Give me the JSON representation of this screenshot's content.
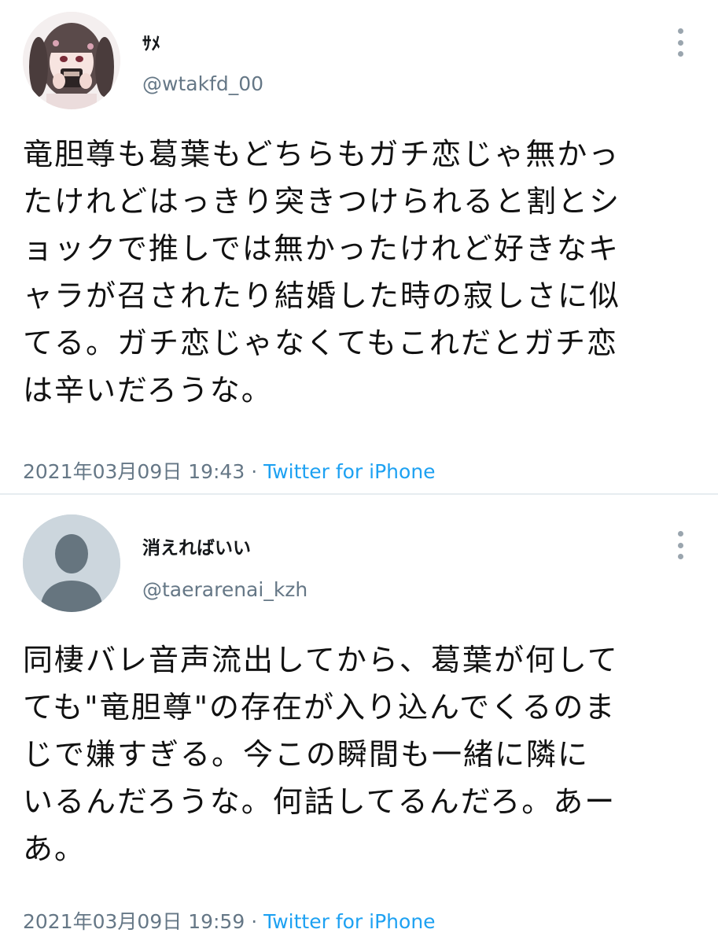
{
  "tweets": [
    {
      "name": "ｻﾒ",
      "handle": "@wtakfd_00",
      "text": "竜胆尊も葛葉もどちらもガチ恋じゃ無かっ\nたけれどはっきり突きつけられると割とシ\nョックで推しでは無かったけれど好きなキ\nャラが召されたり結婚した時の寂しさに似\nてる。ガチ恋じゃなくてもこれだとガチ恋\nは辛いだろうな。",
      "timestamp": "2021年03月09日 19:43",
      "separator": " · ",
      "source": "Twitter for iPhone",
      "avatar_icon": "anime-girl-avatar-icon"
    },
    {
      "name": "消えればいい",
      "handle": "@taerarenai_kzh",
      "text": "同棲バレ音声流出してから、葛葉が何して\nても\"竜胆尊\"の存在が入り込んでくるのま\nじで嫌すぎる。今この瞬間も一緒に隣に\nいるんだろうな。何話してるんだろ。あー\nあ。",
      "timestamp": "2021年03月09日 19:59",
      "separator": " · ",
      "source": "Twitter for iPhone",
      "avatar_icon": "default-user-avatar-icon"
    }
  ],
  "icons": {
    "more": "more-options-vertical-icon"
  },
  "colors": {
    "link": "#1da1f2",
    "secondary": "#657786",
    "divider": "#e6ecf0",
    "default_avatar_bg": "#ccd6dd",
    "default_avatar_fg": "#66757f"
  }
}
